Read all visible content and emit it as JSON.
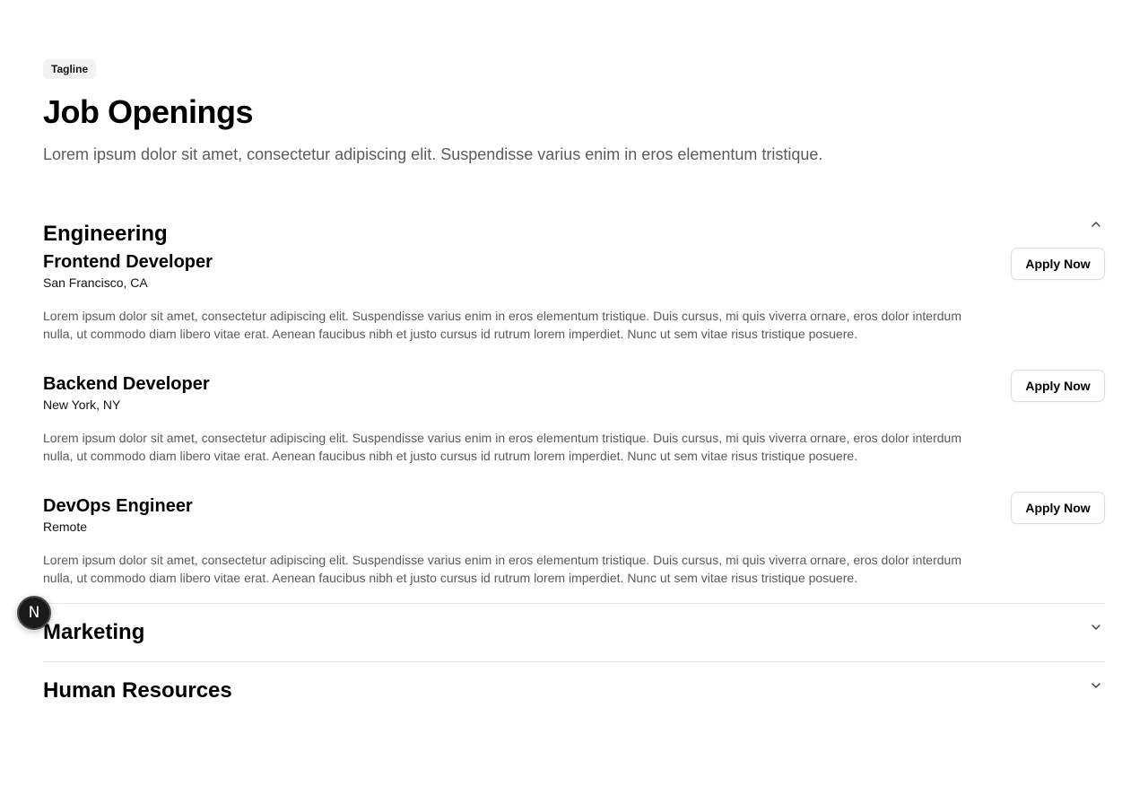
{
  "header": {
    "tagline": "Tagline",
    "title": "Job Openings",
    "subtitle": "Lorem ipsum dolor sit amet, consectetur adipiscing elit. Suspendisse varius enim in eros elementum tristique."
  },
  "departments": [
    {
      "name": "Engineering",
      "expanded": true,
      "chevron_icon": "chevron-up-icon",
      "jobs": [
        {
          "title": "Frontend Developer",
          "location": "San Francisco, CA",
          "description": "Lorem ipsum dolor sit amet, consectetur adipiscing elit. Suspendisse varius enim in eros elementum tristique. Duis cursus, mi quis viverra ornare, eros dolor interdum nulla, ut commodo diam libero vitae erat. Aenean faucibus nibh et justo cursus id rutrum lorem imperdiet. Nunc ut sem vitae risus tristique posuere.",
          "apply_label": "Apply Now"
        },
        {
          "title": "Backend Developer",
          "location": "New York, NY",
          "description": "Lorem ipsum dolor sit amet, consectetur adipiscing elit. Suspendisse varius enim in eros elementum tristique. Duis cursus, mi quis viverra ornare, eros dolor interdum nulla, ut commodo diam libero vitae erat. Aenean faucibus nibh et justo cursus id rutrum lorem imperdiet. Nunc ut sem vitae risus tristique posuere.",
          "apply_label": "Apply Now"
        },
        {
          "title": "DevOps Engineer",
          "location": "Remote",
          "description": "Lorem ipsum dolor sit amet, consectetur adipiscing elit. Suspendisse varius enim in eros elementum tristique. Duis cursus, mi quis viverra ornare, eros dolor interdum nulla, ut commodo diam libero vitae erat. Aenean faucibus nibh et justo cursus id rutrum lorem imperdiet. Nunc ut sem vitae risus tristique posuere.",
          "apply_label": "Apply Now"
        }
      ]
    },
    {
      "name": "Marketing",
      "expanded": false,
      "chevron_icon": "chevron-down-icon"
    },
    {
      "name": "Human Resources",
      "expanded": false,
      "chevron_icon": "chevron-down-icon"
    }
  ],
  "floating_badge": {
    "letter": "N",
    "icon": "nextjs-logo-icon"
  },
  "colors": {
    "text": "#000000",
    "muted": "#5c5c5c",
    "border": "#e5e5e5",
    "tagline_bg": "#f2f2f2",
    "badge_bg": "#1a1a1a"
  }
}
